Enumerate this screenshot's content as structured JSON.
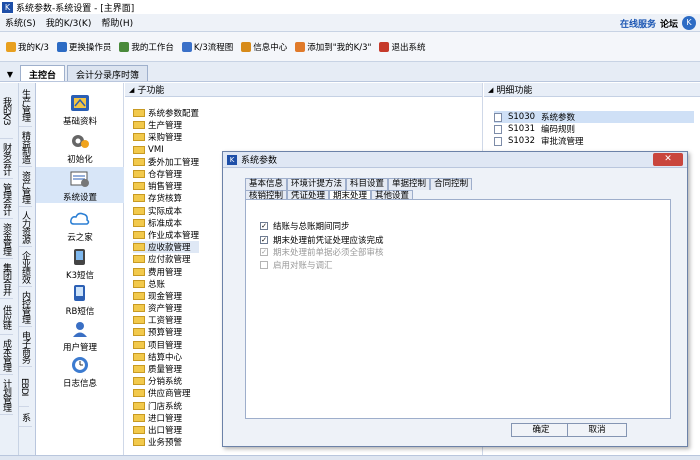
{
  "window": {
    "title": "系统参数-系统设置 - [主界面]",
    "app_icon": "K"
  },
  "menu": {
    "items": [
      "系统(S)",
      "我的K/3(K)",
      "帮助(H)"
    ],
    "right": {
      "service": "在线服务",
      "forum": "论坛"
    }
  },
  "toolbar": {
    "items": [
      {
        "label": "我的K/3",
        "icon": "star-icon",
        "color": "#e8a020"
      },
      {
        "label": "更换操作员",
        "icon": "user-switch-icon",
        "color": "#2c6bc4"
      },
      {
        "label": "我的工作台",
        "icon": "desk-icon",
        "color": "#4a8a3b"
      },
      {
        "label": "K/3流程图",
        "icon": "flowchart-icon",
        "color": "#3a70c8"
      },
      {
        "label": "信息中心",
        "icon": "info-icon",
        "color": "#d78b1a"
      },
      {
        "label": "添加到\"我的K/3\"",
        "icon": "add-icon",
        "color": "#e07a2a"
      },
      {
        "label": "退出系统",
        "icon": "exit-icon",
        "color": "#c63a2b"
      }
    ]
  },
  "tabs": {
    "main": "主控台",
    "second": "会计分录序时簿"
  },
  "leftnav": {
    "col1": [
      "我的K/3",
      "财务会计",
      "管理会计",
      "资金管理",
      "集团合并",
      "供应链",
      "成本管理",
      "计划管理"
    ],
    "col2": [
      "生产管理",
      "精益制造",
      "资产管理",
      "人力资源",
      "企业绩效",
      "内控管理",
      "电子商务",
      "EBDI",
      "系"
    ]
  },
  "modules": [
    {
      "label": "基础资料",
      "icon": "base-data-icon"
    },
    {
      "label": "初始化",
      "icon": "init-icon"
    },
    {
      "label": "系统设置",
      "icon": "settings-icon"
    },
    {
      "label": "云之家",
      "icon": "cloud-icon"
    },
    {
      "label": "K3短信",
      "icon": "sms-icon"
    },
    {
      "label": "RB短信",
      "icon": "rb-sms-icon"
    },
    {
      "label": "用户管理",
      "icon": "user-manage-icon"
    },
    {
      "label": "日志信息",
      "icon": "log-icon"
    }
  ],
  "subpane": {
    "header": "子功能",
    "items": [
      "系统参数配置",
      "生产管理",
      "采购管理",
      "VMI",
      "委外加工管理",
      "仓存管理",
      "销售管理",
      "存货核算",
      "实际成本",
      "标准成本",
      "作业成本管理",
      "应收款管理",
      "应付款管理",
      "费用管理",
      "总账",
      "现金管理",
      "资产管理",
      "工资管理",
      "预算管理",
      "项目管理",
      "结算中心",
      "质量管理",
      "分销系统",
      "供应商管理",
      "门店系统",
      "进口管理",
      "出口管理",
      "业务预警"
    ]
  },
  "detailpane": {
    "header": "明细功能",
    "items": [
      {
        "code": "S1030",
        "name": "系统参数"
      },
      {
        "code": "S1031",
        "name": "编码规则"
      },
      {
        "code": "S1032",
        "name": "审批流管理"
      }
    ]
  },
  "dialog": {
    "title": "系统参数",
    "tabs_row1": [
      "基本信息",
      "环境计提方法",
      "科目设置",
      "单据控制",
      "合同控制"
    ],
    "tabs_row2": [
      "核销控制",
      "凭证处理",
      "期末处理",
      "其他设置"
    ],
    "options": [
      {
        "label": "结账与总账期间同步",
        "checked": "✓",
        "disabled": false
      },
      {
        "label": "期末处理前凭证处理应该完成",
        "checked": "✓",
        "disabled": false
      },
      {
        "label": "期末处理前单据必须全部审核",
        "checked": "✓",
        "disabled": true
      },
      {
        "label": "启用对账与调汇",
        "checked": "",
        "disabled": true
      }
    ],
    "ok": "确定",
    "cancel": "取消"
  },
  "colors": {
    "accent": "#1e4fa8",
    "selection": "#d8e6f8",
    "folder": "#f2c94c",
    "close": "#c9463d"
  }
}
